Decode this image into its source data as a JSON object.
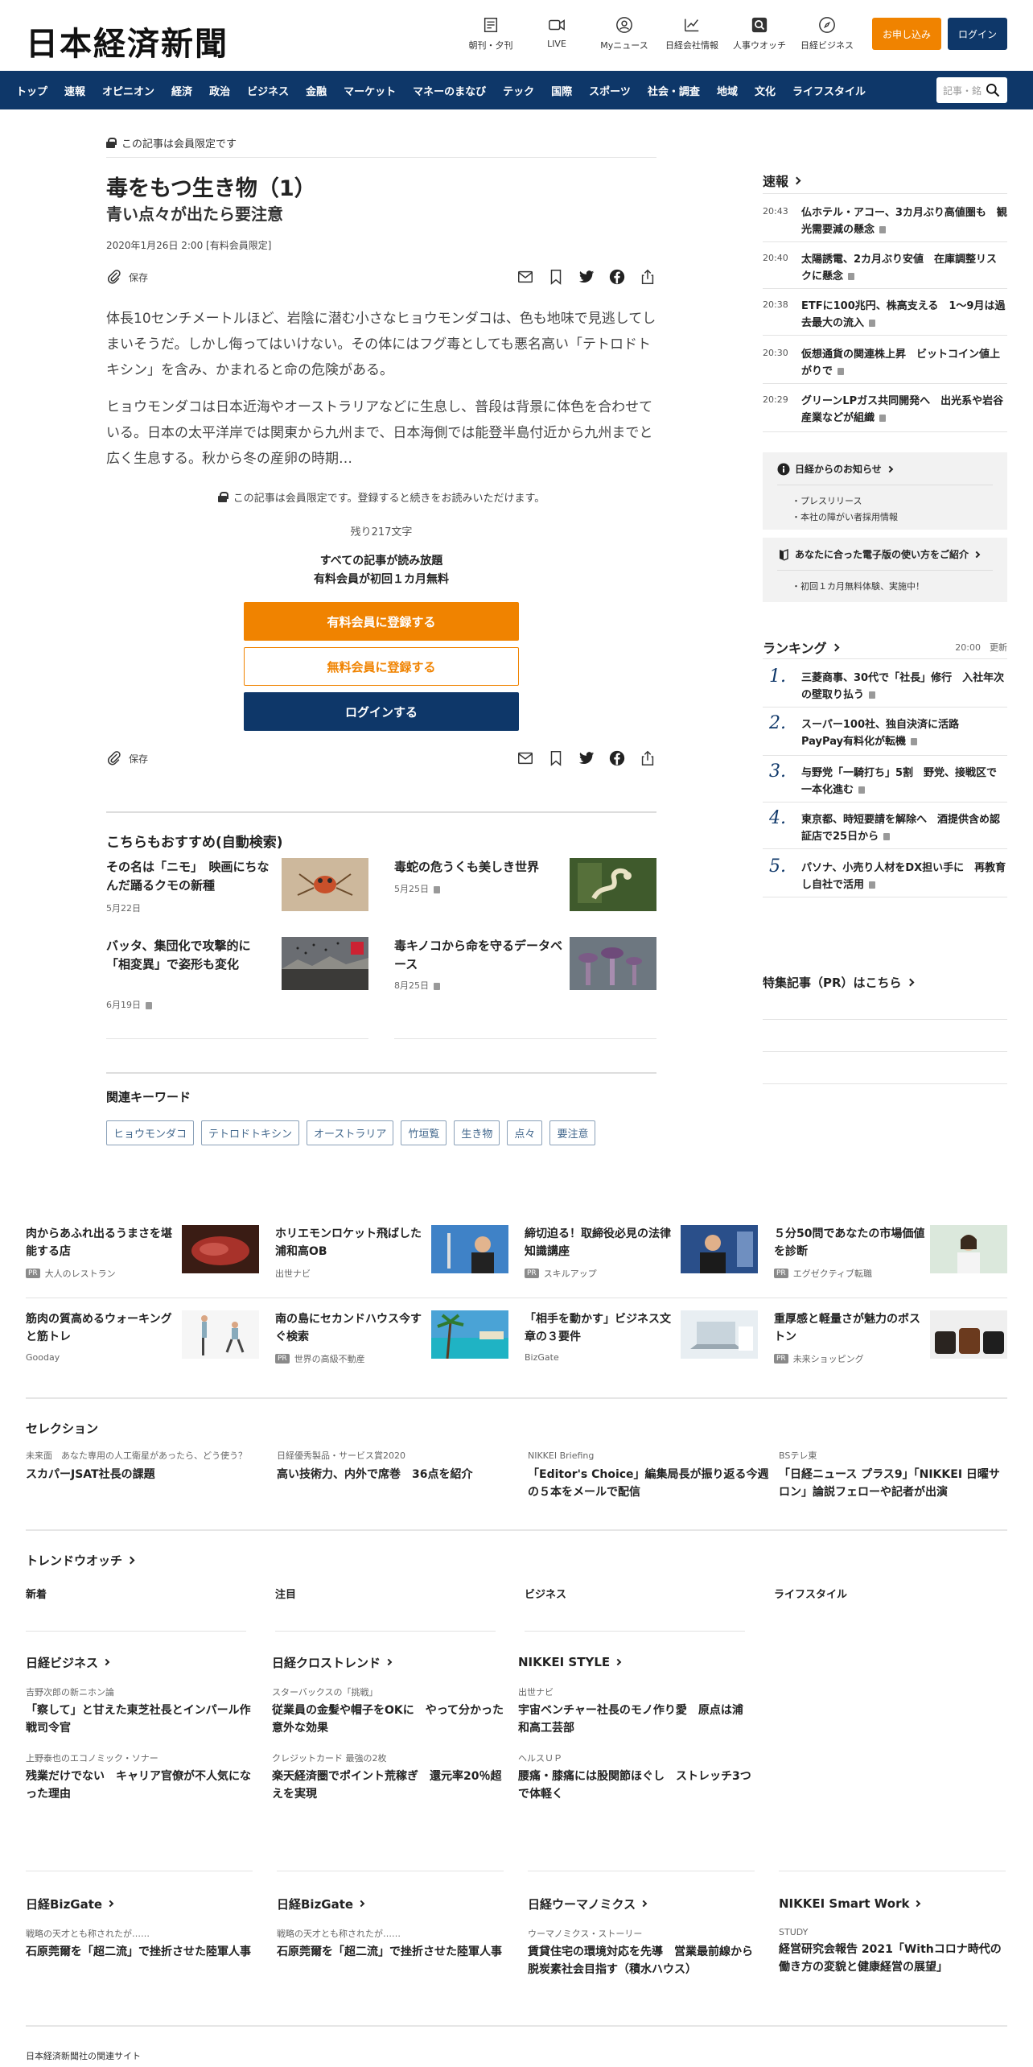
{
  "header": {
    "logo": "日本経済新聞",
    "icons": [
      {
        "label": "朝刊・夕刊",
        "icon": "newspaper-icon"
      },
      {
        "label": "LIVE",
        "icon": "video-icon"
      },
      {
        "label": "Myニュース",
        "icon": "user-icon"
      },
      {
        "label": "日経会社情報",
        "icon": "chart-icon"
      },
      {
        "label": "人事ウオッチ",
        "icon": "search-person-icon"
      },
      {
        "label": "日経ビジネス",
        "icon": "compass-icon"
      }
    ],
    "subscribe_label": "お申し込み",
    "login_label": "ログイン"
  },
  "nav": {
    "items": [
      "トップ",
      "速報",
      "オピニオン",
      "経済",
      "政治",
      "ビジネス",
      "金融",
      "マーケット",
      "マネーのまなび",
      "テック",
      "国際",
      "スポーツ",
      "社会・調査",
      "地域",
      "文化",
      "ライフスタイル"
    ],
    "search_placeholder": "記事・銘"
  },
  "article": {
    "member_only": "この記事は会員限定です",
    "title": "毒をもつ生き物（1）",
    "subtitle": "青い点々が出たら要注意",
    "date": "2020年1月26日 2:00 [有料会員限定]",
    "save_label": "保存",
    "paragraphs": [
      "体長10センチメートルほど、岩陰に潜む小さなヒョウモンダコは、色も地味で見逃してしまいそうだ。しかし侮ってはいけない。その体にはフグ毒としても悪名高い「テトロドトキシン」を含み、かまれると命の危険がある。",
      "ヒョウモンダコは日本近海やオーストラリアなどに生息し、普段は背景に体色を合わせている。日本の太平洋岸では関東から九州まで、日本海側では能登半島付近から九州までと広く生息する。秋から冬の産卵の時期…"
    ],
    "locked_note": "この記事は会員限定です。登録すると続きをお読みいただけます。",
    "remaining": "残り217文字",
    "all_read": "すべての記事が読み放題",
    "first_month_free": "有料会員が初回１カ月無料",
    "cta_paid": "有料会員に登録する",
    "cta_free": "無料会員に登録する",
    "cta_login": "ログインする"
  },
  "recommend": {
    "title": "こちらもおすすめ(自動検索)",
    "items": [
      {
        "title": "その名は「ニモ」　映画にちなんだ踊るクモの新種",
        "date": "5月22日"
      },
      {
        "title": "毒蛇の危うくも美しき世界",
        "date": "5月25日"
      },
      {
        "title": "バッタ、集団化で攻撃的に　「相変異」で姿形も変化",
        "date": "6月19日"
      },
      {
        "title": "毒キノコから命を守るデータベース",
        "date": "8月25日"
      }
    ]
  },
  "keywords": {
    "title": "関連キーワード",
    "items": [
      "ヒョウモンダコ",
      "テトロドトキシン",
      "オーストラリア",
      "竹垣覧",
      "生き物",
      "点々",
      "要注意"
    ]
  },
  "sidebar": {
    "breaking_title": "速報",
    "breaking": [
      {
        "time": "20:43",
        "text": "仏ホテル・アコー、3カ月ぶり高値圏も　観光需要減の懸念"
      },
      {
        "time": "20:40",
        "text": "太陽誘電、2カ月ぶり安値　在庫調整リスクに懸念"
      },
      {
        "time": "20:38",
        "text": "ETFに100兆円、株高支える　1～9月は過去最大の流入"
      },
      {
        "time": "20:30",
        "text": "仮想通貨の関連株上昇　ビットコイン値上がりで"
      },
      {
        "time": "20:29",
        "text": "グリーンLPガス共同開発へ　出光系や岩谷産業などが組織"
      }
    ],
    "notice_title": "日経からのお知らせ",
    "notice_items": [
      "プレスリリース",
      "本社の障がい者採用情報"
    ],
    "guide_title": "あなたに合った電子版の使い方をご紹介",
    "guide_items": [
      "初回１カ月無料体験、実施中！"
    ],
    "ranking_title": "ランキング",
    "ranking_time": "20:00　更新",
    "ranking": [
      {
        "n": "1.",
        "text": "三菱商事、30代で「社長」修行　入社年次の壁取り払う"
      },
      {
        "n": "2.",
        "text": "スーパー100社、独自決済に活路　PayPay有料化が転機"
      },
      {
        "n": "3.",
        "text": "与野党「一騎打ち」5割　野党、接戦区で一本化進む"
      },
      {
        "n": "4.",
        "text": "東京都、時短要請を解除へ　酒提供含め認証店で25日から"
      },
      {
        "n": "5.",
        "text": "パソナ、小売り人材をDX担い手に　再教育し自社で活用"
      }
    ],
    "pr_title": "特集記事（PR）はこちら"
  },
  "ads": [
    {
      "title": "肉からあふれ出るうまさを堪能する店",
      "sub": "大人のレストラン",
      "pr": true
    },
    {
      "title": "ホリエモンロケット飛ばした浦和高OB",
      "sub": "出世ナビ",
      "pr": false
    },
    {
      "title": "締切迫る！取締役必見の法律知識講座",
      "sub": "スキルアップ",
      "pr": true
    },
    {
      "title": "５分50問であなたの市場価値を診断",
      "sub": "エグゼクティブ転職",
      "pr": true
    },
    {
      "title": "筋肉の質高めるウォーキングと筋トレ",
      "sub": "Gooday",
      "pr": false
    },
    {
      "title": "南の島にセカンドハウス今すぐ検索",
      "sub": "世界の高級不動産",
      "pr": true
    },
    {
      "title": "「相手を動かす」ビジネス文章の３要件",
      "sub": "BizGate",
      "pr": false
    },
    {
      "title": "重厚感と軽量さが魅力のボストン",
      "sub": "未来ショッピング",
      "pr": true
    }
  ],
  "pr_tag": "PR",
  "selection": {
    "title": "セレクション",
    "items": [
      {
        "sub": "未来面　あなた専用の人工衛星があったら、どう使う？",
        "title": "スカパーJSAT社長の課題"
      },
      {
        "sub": "日経優秀製品・サービス賞2020",
        "title": "高い技術力、内外で席巻　36点を紹介"
      },
      {
        "sub": "NIKKEI Briefing",
        "title": "「Editor's Choice」編集局長が振り返る今週の５本をメールで配信"
      },
      {
        "sub": "BSテレ東",
        "title": "「日経ニュース プラス9」「NIKKEI 日曜サロン」論説フェローや記者が出演"
      }
    ]
  },
  "trend": {
    "title": "トレンドウオッチ",
    "cols": [
      "新着",
      "注目",
      "ビジネス",
      "ライフスタイル"
    ]
  },
  "media1": [
    {
      "name": "日経ビジネス",
      "items": [
        {
          "sub": "吉野次郎の新ニホン論",
          "title": "「察して」と甘えた東芝社長とインパール作戦司令官"
        },
        {
          "sub": "上野泰也のエコノミック・ソナー",
          "title": "残業だけでない　キャリア官僚が不人気になった理由"
        }
      ]
    },
    {
      "name": "日経クロストレンド",
      "items": [
        {
          "sub": "スターバックスの「挑戦」",
          "title": "従業員の金髪や帽子をOKに　やって分かった意外な効果"
        },
        {
          "sub": "クレジットカード 最強の2枚",
          "title": "楽天経済圏でポイント荒稼ぎ　還元率20％超えを実現"
        }
      ]
    },
    {
      "name": "NIKKEI STYLE",
      "items": [
        {
          "sub": "出世ナビ",
          "title": "宇宙ベンチャー社長のモノ作り愛　原点は浦和高工芸部"
        },
        {
          "sub": "ヘルスＵＰ",
          "title": "腰痛・膝痛には股関節ほぐし　ストレッチ3つで体軽く"
        }
      ]
    }
  ],
  "media2": [
    {
      "name": "日経BizGate",
      "sub": "戦略の天才とも称されたが……",
      "title": "石原莞爾を「超二流」で挫折させた陸軍人事"
    },
    {
      "name": "日経BizGate",
      "sub": "戦略の天才とも称されたが……",
      "title": "石原莞爾を「超二流」で挫折させた陸軍人事"
    },
    {
      "name": "日経ウーマノミクス",
      "sub": "ウーマノミクス・ストーリー",
      "title": "賃貸住宅の環境対応を先導　営業最前線から脱炭素社会目指す（積水ハウス）"
    },
    {
      "name": "NIKKEI Smart Work",
      "sub": "STUDY",
      "title": "経営研究会報告 2021「Withコロナ時代の働き方の変貌と健康経営の展望」"
    }
  ],
  "footer": {
    "related": "日本経済新聞社の関連サイト"
  },
  "colors": {
    "navy": "#0e3769",
    "orange": "#f08300"
  }
}
